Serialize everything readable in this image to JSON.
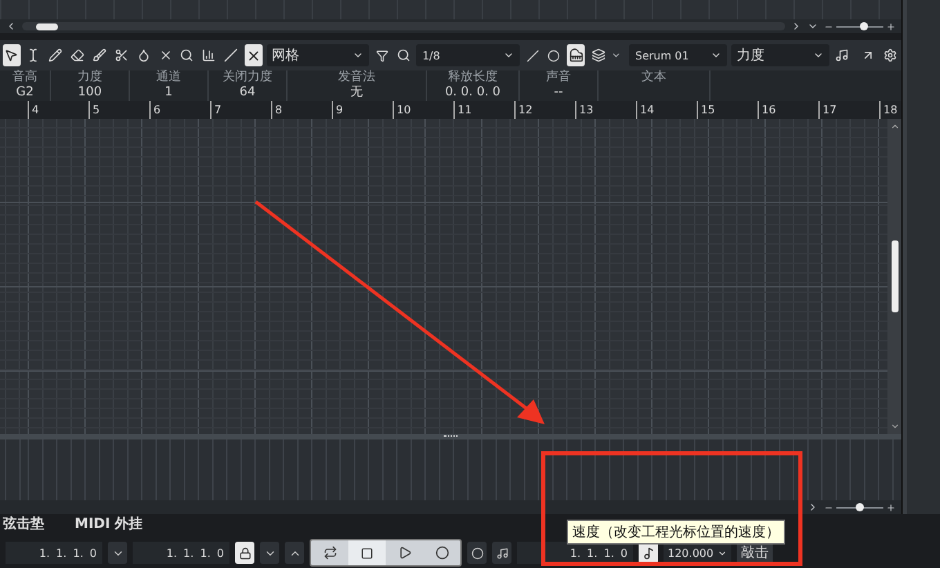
{
  "toolbar": {
    "tools": [
      {
        "kind": "arrow",
        "selected": true
      },
      {
        "kind": "range",
        "selected": false
      },
      {
        "kind": "pencil",
        "selected": false
      },
      {
        "kind": "eraser",
        "selected": false
      },
      {
        "kind": "brush",
        "selected": false
      },
      {
        "kind": "scissors",
        "selected": false
      },
      {
        "kind": "glue",
        "selected": false
      },
      {
        "kind": "mute",
        "selected": false
      },
      {
        "kind": "zoom",
        "selected": false
      },
      {
        "kind": "comb",
        "selected": false
      },
      {
        "kind": "line",
        "selected": false
      }
    ],
    "snap": {
      "on": true,
      "value": "网格"
    },
    "quantize": "1/8",
    "piano_view": {
      "on": true
    },
    "instrument": "Serum 01",
    "lane": "力度"
  },
  "top_zoom": {
    "level": 0.6
  },
  "info": [
    {
      "label": "音高",
      "value": "G2"
    },
    {
      "label": "力度",
      "value": "100"
    },
    {
      "label": "通道",
      "value": "1"
    },
    {
      "label": "关闭力度",
      "value": "64"
    },
    {
      "label": "发音法",
      "value": "无"
    },
    {
      "label": "释放长度",
      "value": "0. 0. 0. 0"
    },
    {
      "label": "声音",
      "value": "--"
    },
    {
      "label": "文本"
    }
  ],
  "ruler": [
    "4",
    "5",
    "6",
    "7",
    "8",
    "9",
    "10",
    "11",
    "12",
    "13",
    "14",
    "15",
    "16",
    "17",
    "18"
  ],
  "bottom_zoom": {
    "level": 0.5
  },
  "status_tabs": [
    "弦击垫",
    "MIDI 外挂"
  ],
  "transport": {
    "left_locator": "1. 1. 1. 0",
    "lock": {
      "on": true
    },
    "right_locator": "1. 1. 1. 0",
    "position": "1. 1. 1. 0",
    "tempo_track": {
      "on": true
    },
    "tempo": "120.000",
    "tap": "敲击",
    "tooltip": "速度（改变工程光标位置的速度）"
  }
}
